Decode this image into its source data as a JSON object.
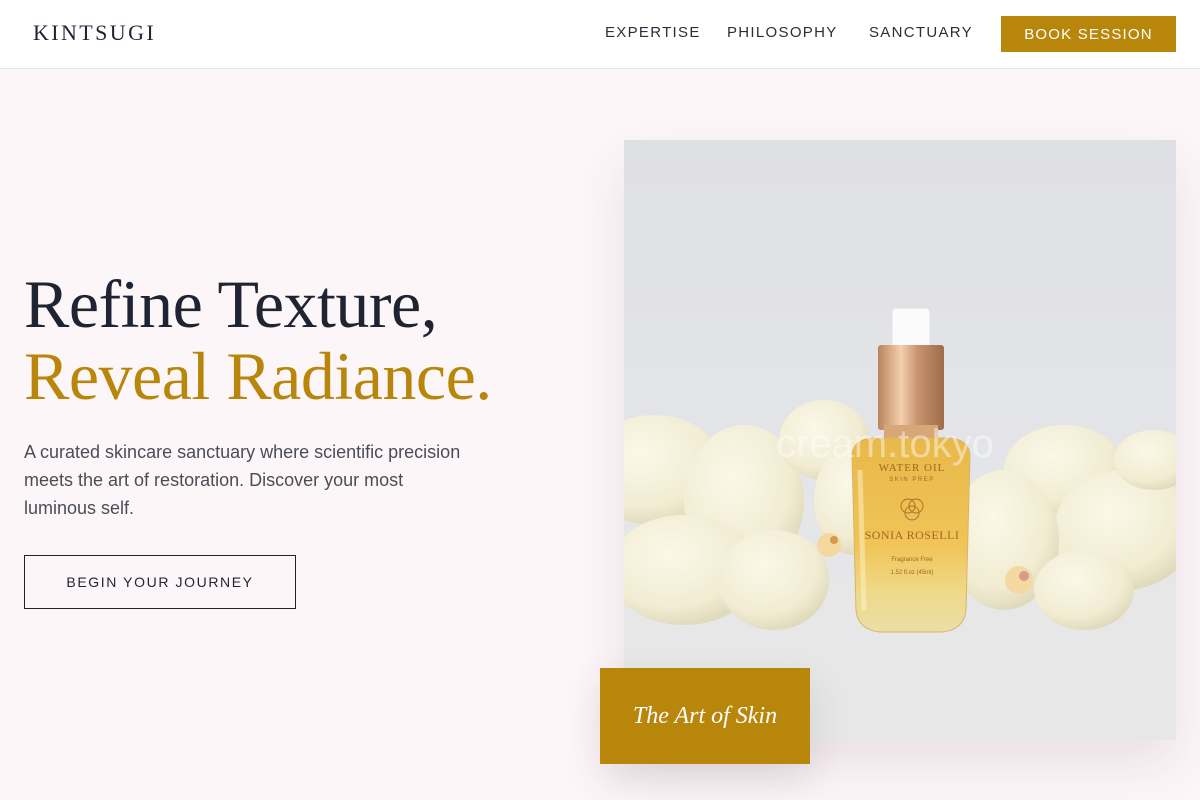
{
  "brand": {
    "logo": "KINTSUGI"
  },
  "nav": {
    "links": [
      "EXPERTISE",
      "PHILOSOPHY",
      "SANCTUARY"
    ],
    "book_label": "BOOK SESSION"
  },
  "hero": {
    "headline_line1": "Refine Texture,",
    "headline_line2": "Reveal Radiance.",
    "description": "A curated skincare sanctuary where scientific precision meets the art of restoration. Discover your most luminous self.",
    "cta_label": "BEGIN YOUR JOURNEY"
  },
  "product_image": {
    "watermark": "cream.tokyo",
    "label_title": "WATER OIL",
    "label_subtitle": "SKIN PREP",
    "brand": "SONIA ROSELLI",
    "scent": "Fragrance Free",
    "volume": "1.52 fl.oz (45ml)",
    "caption": "The Art of Skin"
  },
  "colors": {
    "accent_gold": "#b8860b",
    "ink": "#1f2433",
    "background": "#fdf6f8"
  }
}
